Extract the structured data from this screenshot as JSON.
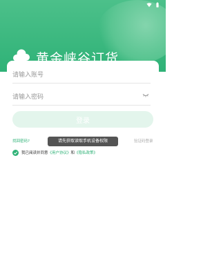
{
  "status_bar": {
    "icons": [
      "wifi-icon",
      "battery-icon"
    ]
  },
  "header": {
    "logo_icon": "cloud-logo-icon",
    "title": "黄金峡谷订货"
  },
  "login": {
    "account_placeholder": "请输入账号",
    "password_placeholder": "请输入密码",
    "password_toggle_icon": "eye-closed-icon",
    "submit_label": "登录",
    "forgot_label": "找回密码?",
    "code_login_label": "验证码登录"
  },
  "agreement": {
    "checked": true,
    "prefix": "我已阅读并同意",
    "user_agreement": "《用户协议》",
    "conjunction": "和",
    "privacy_policy": "《隐私政策》"
  },
  "toast": {
    "message": "请先获取读取手机设备权限"
  },
  "colors": {
    "brand": "#2fb277",
    "button_disabled": "#e3f5ec",
    "toast_bg": "#3c3c3c",
    "placeholder": "#999999"
  }
}
